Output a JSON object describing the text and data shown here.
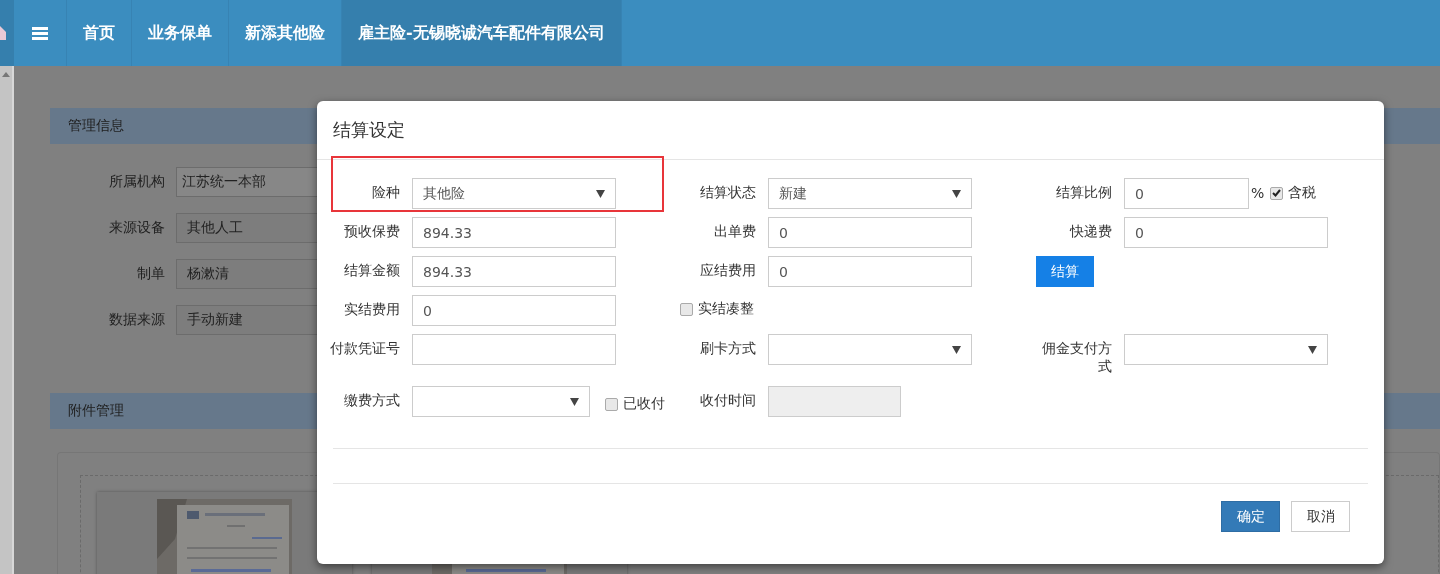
{
  "nav": {
    "tabs": [
      {
        "label": "首页",
        "selected": false
      },
      {
        "label": "业务保单",
        "selected": false
      },
      {
        "label": "新添其他险",
        "selected": false
      },
      {
        "label": "雇主险-无锡晓诚汽车配件有限公司",
        "selected": true
      }
    ]
  },
  "page": {
    "sections": [
      {
        "title": "管理信息",
        "fields": [
          {
            "label": "所属机构",
            "value": "江苏统一本部"
          },
          {
            "label": "来源设备",
            "value": "其他人工"
          },
          {
            "label": "制单",
            "value": "杨漱清"
          },
          {
            "label": "数据来源",
            "value": "手动新建"
          }
        ]
      },
      {
        "title": "附件管理"
      }
    ]
  },
  "dialog": {
    "title": "结算设定",
    "rows": [
      [
        {
          "kind": "select",
          "label": "险种",
          "value": "其他险"
        },
        {
          "kind": "select",
          "label": "结算状态",
          "value": "新建"
        },
        {
          "kind": "ratio",
          "label": "结算比例",
          "value": "0",
          "unit": "%",
          "check": {
            "label": "含税",
            "checked": true
          }
        }
      ],
      [
        {
          "kind": "input",
          "label": "预收保费",
          "value": "894.33",
          "disabled": false
        },
        {
          "kind": "input",
          "label": "出单费",
          "value": "0",
          "disabled": false
        },
        {
          "kind": "input",
          "label": "快递费",
          "value": "0",
          "disabled": false
        }
      ],
      [
        {
          "kind": "input",
          "label": "结算金额",
          "value": "894.33",
          "disabled": false
        },
        {
          "kind": "input",
          "label": "应结费用",
          "value": "0",
          "disabled": false
        },
        {
          "kind": "button",
          "label": "结算"
        }
      ],
      [
        {
          "kind": "input",
          "label": "实结费用",
          "value": "0",
          "disabled": false
        },
        {
          "kind": "checkbox",
          "label": "实结凑整",
          "checked": false
        },
        {
          "kind": "blank"
        }
      ],
      [
        {
          "kind": "input",
          "label": "付款凭证号",
          "disabled": false
        },
        {
          "kind": "select",
          "label": "刷卡方式"
        },
        {
          "kind": "select",
          "label": "佣金支付方式"
        }
      ],
      [
        {
          "kind": "select_check",
          "label": "缴费方式",
          "check": {
            "label": "已收付",
            "checked": false
          }
        },
        {
          "kind": "input",
          "label": "收付时间",
          "disabled": true
        },
        {
          "kind": "blank"
        }
      ]
    ],
    "buttons": [
      {
        "label": "确定",
        "kind": "primary"
      },
      {
        "label": "取消",
        "kind": "default"
      }
    ]
  }
}
